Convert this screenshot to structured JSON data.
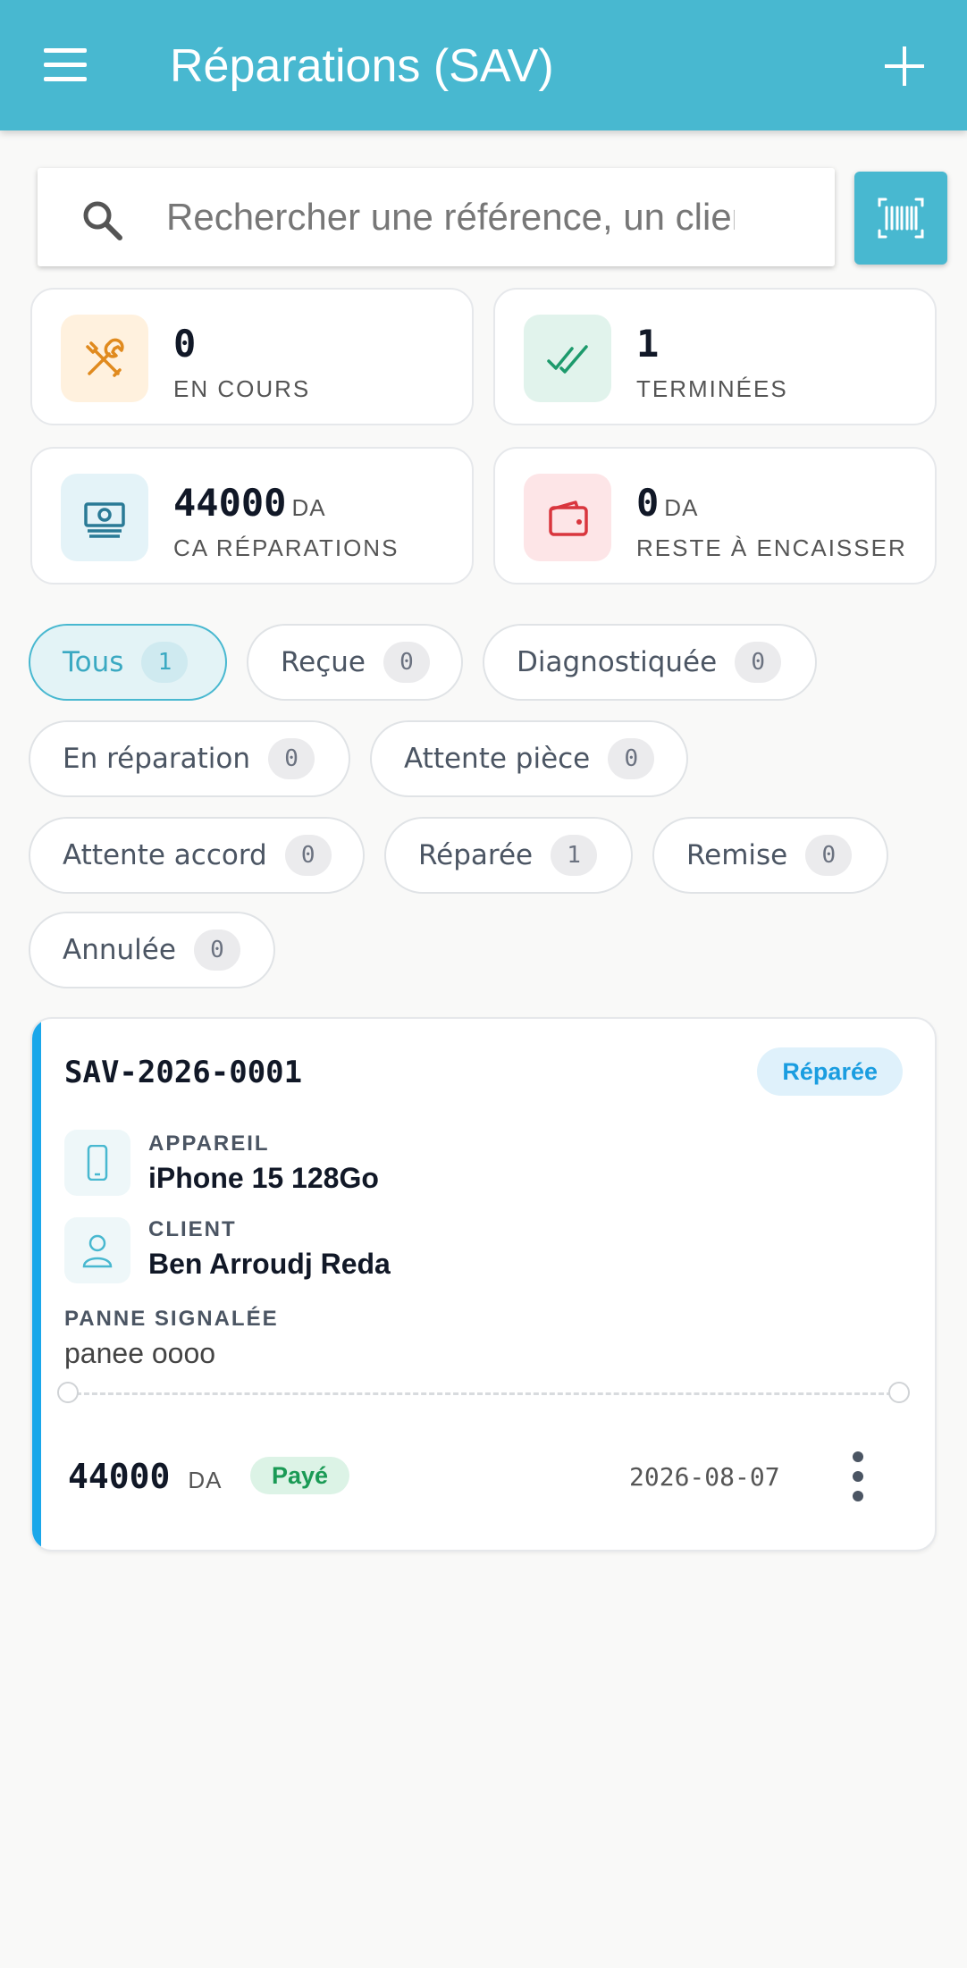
{
  "header": {
    "title": "Réparations (SAV)"
  },
  "search": {
    "placeholder": "Rechercher une référence, un client"
  },
  "stats": [
    {
      "icon": "tools-icon",
      "value": "0",
      "unit": "",
      "label": "EN COURS"
    },
    {
      "icon": "double-check-icon",
      "value": "1",
      "unit": "",
      "label": "TERMINÉES"
    },
    {
      "icon": "banknote-icon",
      "value": "44000",
      "unit": "DA",
      "label": "CA RÉPARATIONS"
    },
    {
      "icon": "wallet-icon",
      "value": "0",
      "unit": "DA",
      "label": "RESTE À ENCAISSER"
    }
  ],
  "filters": [
    {
      "label": "Tous",
      "count": "1",
      "active": true
    },
    {
      "label": "Reçue",
      "count": "0"
    },
    {
      "label": "Diagnostiquée",
      "count": "0"
    },
    {
      "label": "En réparation",
      "count": "0"
    },
    {
      "label": "Attente pièce",
      "count": "0"
    },
    {
      "label": "Attente accord",
      "count": "0"
    },
    {
      "label": "Réparée",
      "count": "1"
    },
    {
      "label": "Remise",
      "count": "0"
    },
    {
      "label": "Annulée",
      "count": "0"
    }
  ],
  "repairs": [
    {
      "reference": "SAV-2026-0001",
      "status": "Réparée",
      "device_label": "APPAREIL",
      "device": "iPhone 15 128Go",
      "client_label": "CLIENT",
      "client": "Ben Arroudj Reda",
      "issue_label": "PANNE SIGNALÉE",
      "issue": "panee oooo",
      "amount": "44000",
      "currency": "DA",
      "payment_status": "Payé",
      "date": "2026-08-07"
    }
  ],
  "colors": {
    "primary": "#48b8d0",
    "accent_bar": "#1aa7ea",
    "status_repaired": "#1a9de0",
    "paid": "#1a9a55"
  }
}
